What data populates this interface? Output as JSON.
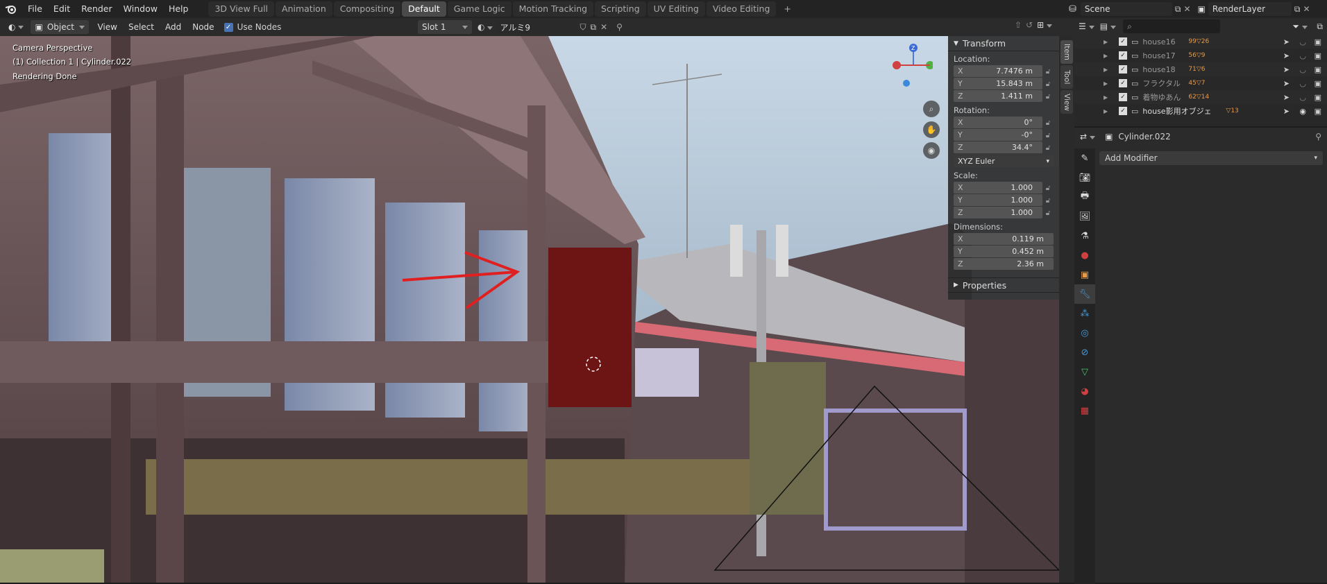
{
  "menubar": {
    "menus": [
      "File",
      "Edit",
      "Render",
      "Window",
      "Help"
    ],
    "workspaces": [
      "3D View Full",
      "Animation",
      "Compositing",
      "Default",
      "Game Logic",
      "Motion Tracking",
      "Scripting",
      "UV Editing",
      "Video Editing"
    ],
    "active_workspace": "Default",
    "add_tab": "+",
    "scene": "Scene",
    "render_layer": "RenderLayer"
  },
  "viewport_header": {
    "mode": "Object",
    "menus": [
      "View",
      "Select",
      "Add",
      "Node"
    ],
    "use_nodes_label": "Use Nodes",
    "slot": "Slot 1",
    "material": "アルミ9"
  },
  "viewport": {
    "camera_label": "Camera Perspective",
    "collection_label": "(1) Collection 1 | Cylinder.022",
    "render_status": "Rendering Done",
    "gizmo_z": "Z"
  },
  "n_panel": {
    "transform_title": "Transform",
    "location_label": "Location:",
    "location": [
      {
        "axis": "X",
        "value": "7.7476 m"
      },
      {
        "axis": "Y",
        "value": "15.843 m"
      },
      {
        "axis": "Z",
        "value": "1.411 m"
      }
    ],
    "rotation_label": "Rotation:",
    "rotation": [
      {
        "axis": "X",
        "value": "0°"
      },
      {
        "axis": "Y",
        "value": "-0°"
      },
      {
        "axis": "Z",
        "value": "34.4°"
      }
    ],
    "rotation_mode": "XYZ Euler",
    "scale_label": "Scale:",
    "scale": [
      {
        "axis": "X",
        "value": "1.000"
      },
      {
        "axis": "Y",
        "value": "1.000"
      },
      {
        "axis": "Z",
        "value": "1.000"
      }
    ],
    "dimensions_label": "Dimensions:",
    "dimensions": [
      {
        "axis": "X",
        "value": "0.119 m"
      },
      {
        "axis": "Y",
        "value": "0.452 m"
      },
      {
        "axis": "Z",
        "value": "2.36 m"
      }
    ],
    "properties_title": "Properties",
    "tabs": [
      "Item",
      "Tool",
      "View"
    ]
  },
  "outliner": {
    "rows": [
      {
        "name": "house16",
        "n1": "99",
        "n2": "26"
      },
      {
        "name": "house17",
        "n1": "56",
        "n2": "9"
      },
      {
        "name": "house18",
        "n1": "71",
        "n2": "6"
      },
      {
        "name": "フラクタル",
        "n1": "45",
        "n2": "7"
      },
      {
        "name": "着物ゆあん",
        "n1": "62",
        "n2": "14"
      },
      {
        "name": "house影用オブジェ",
        "n1": "",
        "n2": "13"
      }
    ]
  },
  "properties": {
    "object_name": "Cylinder.022",
    "add_modifier": "Add Modifier"
  },
  "colors": {
    "accent": "#4772b3",
    "active_tab": "#4a4a4a",
    "wrench_blue": "#4a9bd6"
  }
}
